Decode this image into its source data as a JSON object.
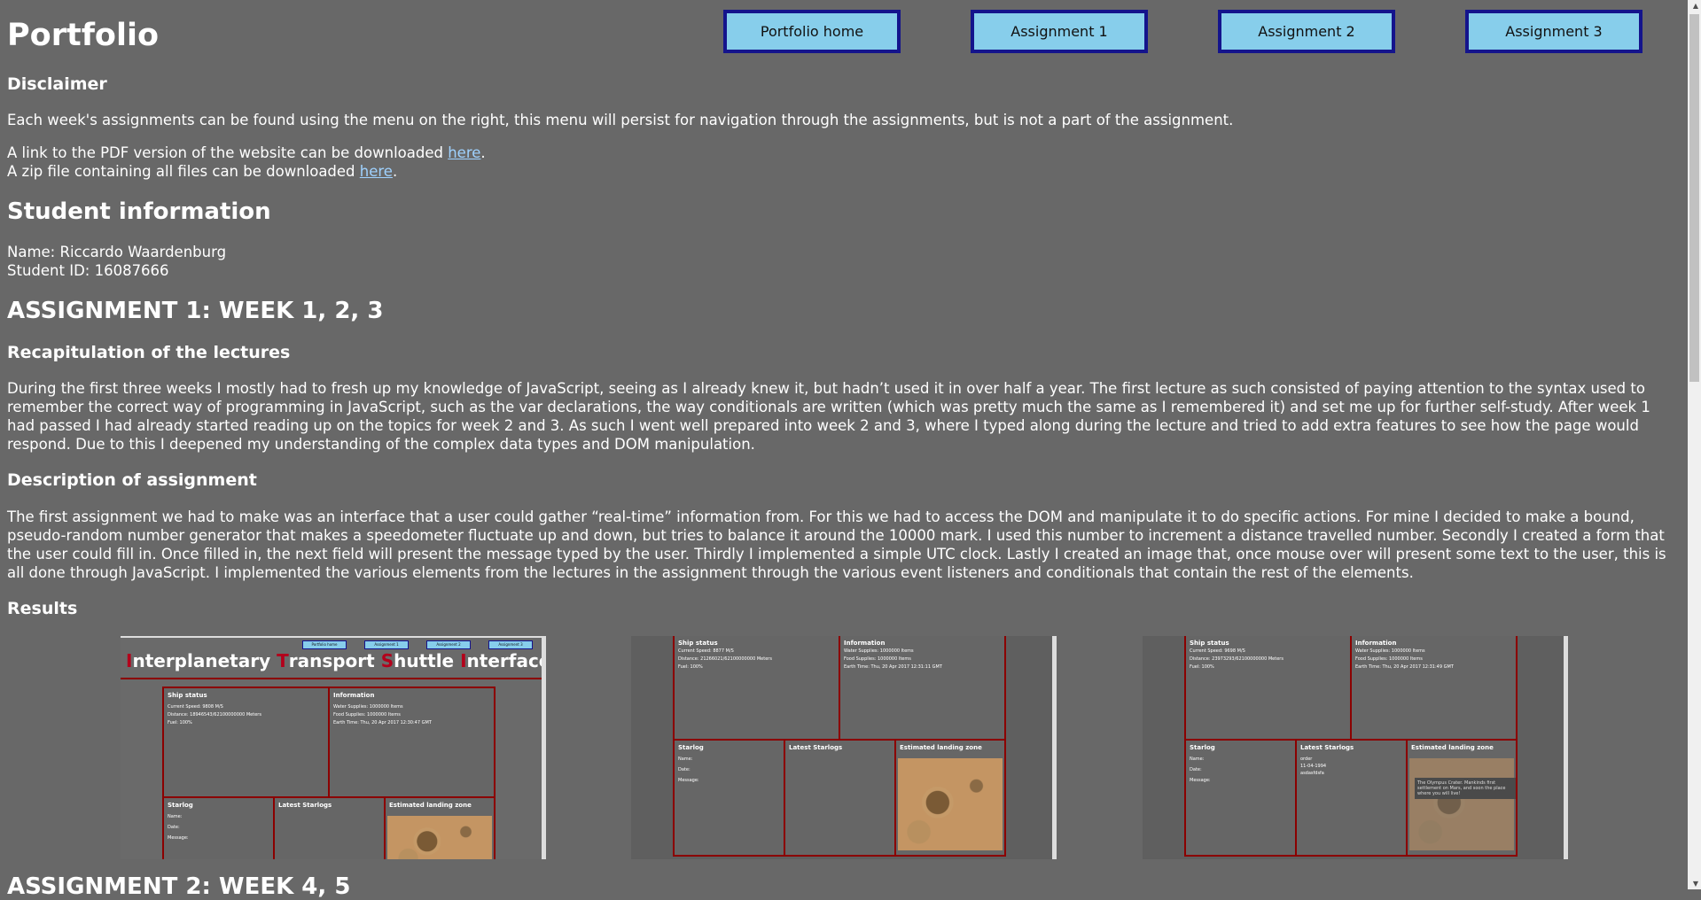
{
  "header": {
    "title": "Portfolio"
  },
  "nav": [
    "Portfolio home",
    "Assignment 1",
    "Assignment 2",
    "Assignment 3"
  ],
  "disclaimer": {
    "heading": "Disclaimer",
    "text": "Each week's assignments can be found using the menu on the right, this menu will persist for navigation through the assignments, but is not a part of the assignment.",
    "pdf_pre": "A link to the PDF version of the website can be downloaded ",
    "pdf_link": "here",
    "pdf_post": ".",
    "zip_pre": "A zip file containing all files can be downloaded ",
    "zip_link": "here",
    "zip_post": "."
  },
  "student": {
    "heading": "Student information",
    "name": "Name: Riccardo Waardenburg",
    "id": "Student ID: 16087666"
  },
  "assignment1": {
    "heading": "ASSIGNMENT 1: WEEK 1, 2, 3",
    "recap_heading": "Recapitulation of the lectures",
    "recap_text": "During the first three weeks I mostly had to fresh up my knowledge of JavaScript, seeing as I already knew it, but hadn’t used it in over half a year. The first lecture as such consisted of paying attention to the syntax used to remember the correct way of programming in JavaScript, such as the var declarations, the way conditionals are written (which was pretty much the same as I remembered it) and set me up for further self-study. After week 1 had passed I had already started reading up on the topics for week 2 and 3. As such I went well prepared into week 2 and 3, where I typed along during the lecture and tried to add extra features to see how the page would respond. Due to this I deepened my understanding of the complex data types and DOM manipulation.",
    "desc_heading": "Description of assignment",
    "desc_text": "The first assignment we had to make was an interface that a user could gather “real-time” information from. For this we had to access the DOM and manipulate it to do specific actions. For mine I decided to make a bound, pseudo-random number generator that makes a speedometer fluctuate up and down, but tries to balance it around the 10000 mark. I used this number to increment a distance travelled number. Secondly I created a form that the user could fill in. Once filled in, the next field will present the message typed by the user. Thirdly I implemented a simple UTC clock. Lastly I created an image that, once mouse over will present some text to the user, this is all done through JavaScript. I implemented the various elements from the lectures in the assignment through the various event listeners and conditionals that contain the rest of the elements.",
    "results_heading": "Results"
  },
  "next_heading": "ASSIGNMENT 2: WEEK 4, 5",
  "screenshots": {
    "app_title_parts": [
      "I",
      "nterplanetary ",
      "T",
      "ransport ",
      "S",
      "huttle ",
      "I",
      "nterface"
    ],
    "mini_nav": [
      "Portfolio home",
      "Assignment 1",
      "Assignment 2",
      "Assignment 3"
    ],
    "ship_status": "Ship status",
    "information": "Information",
    "starlog": "Starlog",
    "latest_starlogs": "Latest Starlogs",
    "landing_zone": "Estimated landing zone",
    "fuel": "Fuel: 100%",
    "water": "Water Supplies: 1000000 Items",
    "food": "Food Supplies: 1000000 Items",
    "name_label": "Name:",
    "date_label": "Date:",
    "message_label": "Message:",
    "shot1": {
      "speed": "Current Speed: 9808 M/S",
      "distance": "Distance: 18946543/62100000000 Meters",
      "time": "Earth Time: Thu, 20 Apr 2017 12:30:47 GMT"
    },
    "shot2": {
      "speed": "Current Speed: 8877 M/S",
      "distance": "Distance: 21266021/62100000000 Meters",
      "time": "Earth Time: Thu, 20 Apr 2017 12:31:11 GMT"
    },
    "shot3": {
      "speed": "Current Speed: 9698 M/S",
      "distance": "Distance: 23973293/62100000000 Meters",
      "time": "Earth Time: Thu, 20 Apr 2017 12:31:49 GMT",
      "log_entries": [
        "order",
        "11-04-1994",
        "asdasfdsfa"
      ],
      "tooltip": "The Olympus Crater. Mankinds first settlement on Mars, and soon the place where you will live!"
    }
  }
}
